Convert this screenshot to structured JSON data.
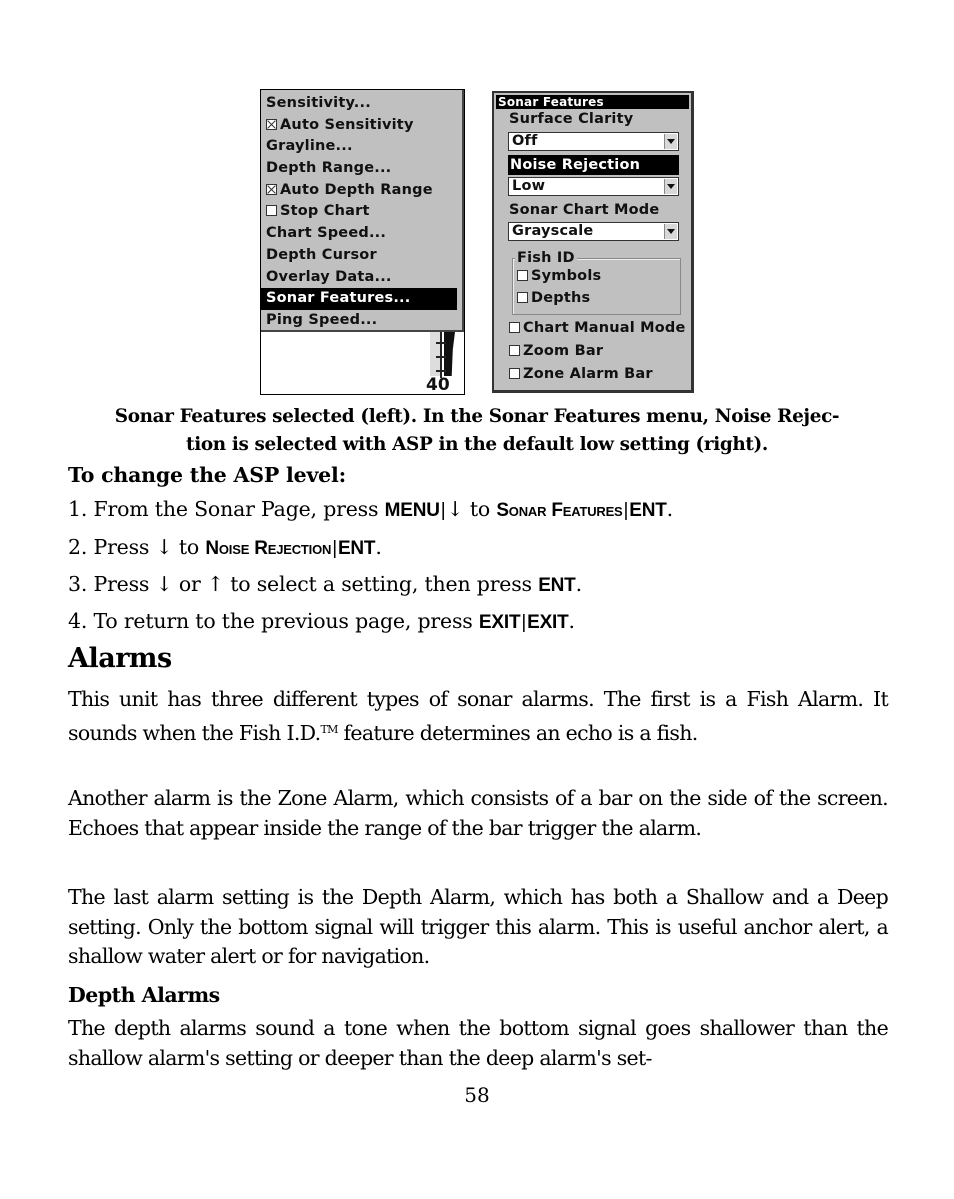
{
  "figure": {
    "left_screen": {
      "menu_items": [
        {
          "label": "Sensitivity...",
          "checkbox": null,
          "selected": false
        },
        {
          "label": "Auto Sensitivity",
          "checkbox": true,
          "selected": false
        },
        {
          "label": "Grayline...",
          "checkbox": null,
          "selected": false
        },
        {
          "label": "Depth Range...",
          "checkbox": null,
          "selected": false
        },
        {
          "label": "Auto Depth Range",
          "checkbox": true,
          "selected": false
        },
        {
          "label": "Stop Chart",
          "checkbox": false,
          "selected": false
        },
        {
          "label": "Chart Speed...",
          "checkbox": null,
          "selected": false
        },
        {
          "label": "Depth Cursor",
          "checkbox": null,
          "selected": false
        },
        {
          "label": "Overlay Data...",
          "checkbox": null,
          "selected": false
        },
        {
          "label": "Sonar Features...",
          "checkbox": null,
          "selected": true
        },
        {
          "label": "Ping Speed...",
          "checkbox": null,
          "selected": false
        }
      ],
      "depth_scale_label": "40"
    },
    "right_screen": {
      "title": "Sonar Features",
      "surface_clarity": {
        "label": "Surface Clarity",
        "value": "Off"
      },
      "noise_rejection": {
        "label": "Noise Rejection",
        "value": "Low",
        "selected": true
      },
      "sonar_chart_mode": {
        "label": "Sonar Chart Mode",
        "value": "Grayscale"
      },
      "fish_id": {
        "label": "Fish ID",
        "options": [
          {
            "label": "Symbols",
            "checked": false
          },
          {
            "label": "Depths",
            "checked": false
          }
        ]
      },
      "checkboxes": [
        {
          "label": "Chart Manual Mode",
          "checked": false
        },
        {
          "label": "Zoom Bar",
          "checked": false
        },
        {
          "label": "Zone Alarm Bar",
          "checked": false
        }
      ]
    },
    "caption_line1": "Sonar Features selected (left). In the Sonar Features menu, Noise Rejec-",
    "caption_line2": "tion is selected with ASP in the default low setting (right)."
  },
  "procedure": {
    "heading": "To change the ASP level:",
    "steps": {
      "s1": {
        "prefix": "1. From the Sonar Page, press ",
        "key1": "MENU",
        "sep": "|",
        "arrow": "↓",
        "mid": " to ",
        "key2": "Sonar Features",
        "key3": "ENT",
        "end": "."
      },
      "s2": {
        "prefix": "2. Press ",
        "arrow": "↓",
        "mid": " to ",
        "key1": "Noise Rejection",
        "sep": "|",
        "key2": "ENT",
        "end": "."
      },
      "s3": {
        "prefix": "3. Press ",
        "arrow_down": "↓",
        "or": " or ",
        "arrow_up": "↑",
        "mid": " to select a setting, then press ",
        "key1": "ENT",
        "end": "."
      },
      "s4": {
        "prefix": "4. To return to the previous page, press ",
        "key1": "EXIT",
        "sep": "|",
        "key2": "EXIT",
        "end": "."
      }
    }
  },
  "alarms": {
    "heading": "Alarms",
    "para1_a": "This unit has three different types of sonar alarms. The first is a Fish Alarm. It sounds when the Fish I.D.",
    "para1_tm": "TM",
    "para1_b": " feature determines an echo is a fish.",
    "para2": "Another alarm is the Zone Alarm, which consists of a bar on the side of the screen. Echoes that appear inside the range of the bar trigger the alarm.",
    "para3": "The last alarm setting is the Depth Alarm, which has both a Shallow and a Deep setting. Only the bottom signal will trigger this alarm. This is useful anchor alert, a shallow water alert or for navigation.",
    "depth_heading": "Depth Alarms",
    "para4": "The depth alarms sound a tone when the bottom signal goes shallower than the shallow alarm's setting or deeper than the deep alarm's set-"
  },
  "page_number": "58"
}
